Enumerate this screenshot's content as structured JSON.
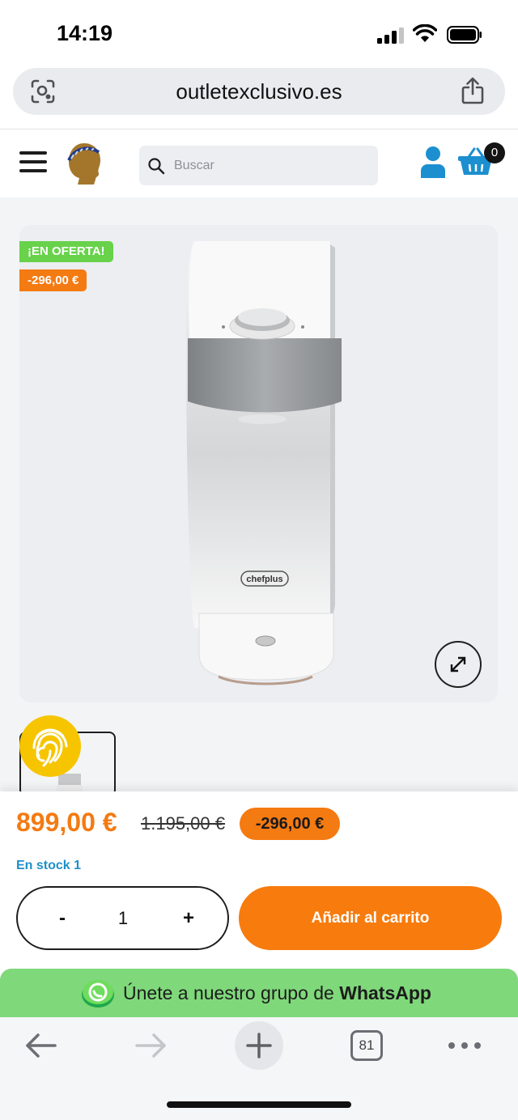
{
  "status_bar": {
    "time": "14:19"
  },
  "browser": {
    "url": "outletexclusivo.es",
    "tab_count": "81"
  },
  "header": {
    "search_placeholder": "Buscar",
    "cart_count": "0"
  },
  "product": {
    "badge_offer": "¡EN OFERTA!",
    "badge_discount": "-296,00 €",
    "brand_mark": "chefplus",
    "price": "899,00 €",
    "old_price": "1.195,00 €",
    "discount_pill": "-296,00 €",
    "stock": "En stock 1",
    "quantity": "1",
    "qty_minus": "-",
    "qty_plus": "+",
    "add_to_cart": "Añadir al carrito"
  },
  "whatsapp": {
    "text_pre": "Únete a nuestro grupo de ",
    "text_bold": "WhatsApp"
  },
  "colors": {
    "accent_orange": "#f47a12",
    "offer_green": "#67d24a",
    "stock_blue": "#1f90c8",
    "whatsapp_green": "#7fd87a",
    "user_blue": "#1c8fd0"
  }
}
